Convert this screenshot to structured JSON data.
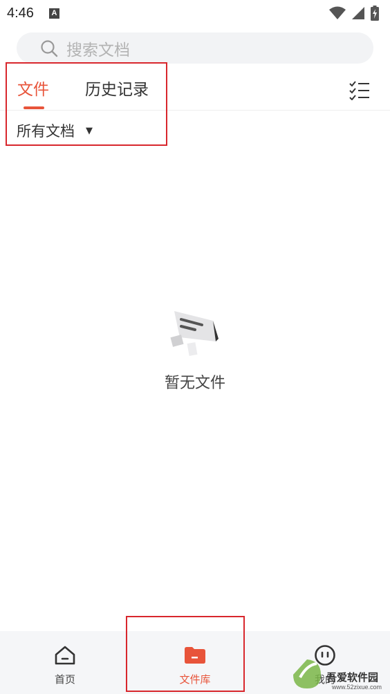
{
  "status_bar": {
    "time": "4:46",
    "badge": "A"
  },
  "search": {
    "placeholder": "搜索文档"
  },
  "tabs": [
    {
      "label": "文件",
      "active": true
    },
    {
      "label": "历史记录",
      "active": false
    }
  ],
  "filter": {
    "label": "所有文档"
  },
  "empty_state": {
    "text": "暂无文件"
  },
  "bottom_nav": [
    {
      "label": "首页",
      "icon": "home-icon",
      "active": false
    },
    {
      "label": "文件库",
      "icon": "folder-icon",
      "active": true
    },
    {
      "label": "我的",
      "icon": "smiley-icon",
      "active": false
    }
  ],
  "watermark": {
    "text": "吾爱软件园",
    "url": "www.52zixue.com"
  },
  "colors": {
    "accent": "#e8543a",
    "highlight": "#d8262c",
    "search_bg": "#f2f3f5",
    "nav_bg": "#f5f6f8"
  }
}
